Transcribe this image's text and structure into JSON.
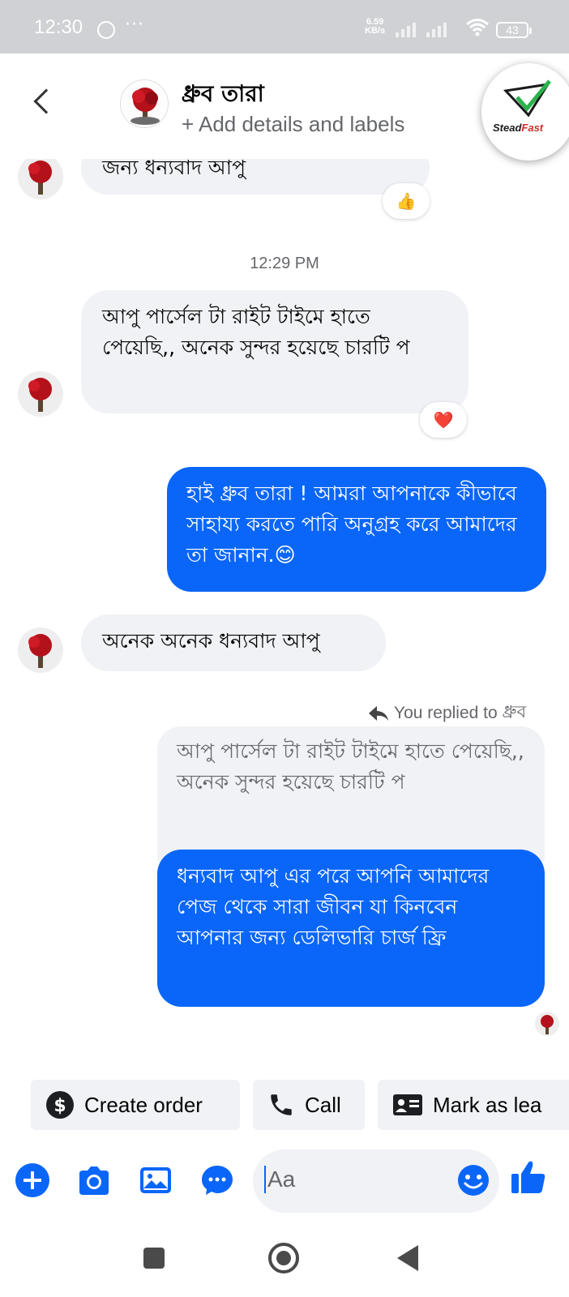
{
  "status_bar": {
    "time": "12:30",
    "dots": "···",
    "net_speed_value": "6.59",
    "net_speed_unit": "KB/s",
    "battery": "43"
  },
  "header": {
    "contact_name": "ধ্রুব তারা",
    "subtitle": "+ Add details and labels",
    "brand_name_a": "Stead",
    "brand_name_b": "Fast"
  },
  "messages": {
    "m1_text": "জন্য ধন্যবাদ আপু",
    "m1_reaction": "👍",
    "time_separator": "12:29 PM",
    "m2_text": "আপু পার্সেল টা রাইট টাইমে হাতে পেয়েছি,, অনেক সুন্দর হয়েছে চারটি প",
    "m2_reaction": "❤️",
    "m3_text": "হাই ধ্রুব তারা ! আমরা আপনাকে কীভাবে সাহায্য করতে পারি অনুগ্রহ করে আমাদের তা জানান.😊",
    "m4_text": "অনেক অনেক ধন্যবাদ আপু",
    "replied_label": "You replied to",
    "replied_name": "ধ্রুব",
    "quoted_text": "আপু পার্সেল টা রাইট টাইমে হাতে পেয়েছি,, অনেক সুন্দর হয়েছে চারটি প",
    "m5_text": "ধন্যবাদ আপু এর পরে আপনি আমাদের পেজ থেকে সারা জীবন যা কিনবেন আপনার জন্য ডেলিভারি চার্জ ফ্রি"
  },
  "quick_actions": {
    "create_order": "Create order",
    "call": "Call",
    "mark_as_lead": "Mark as lea"
  },
  "composer": {
    "placeholder": "Aa"
  },
  "colors": {
    "accent": "#0a66f8",
    "incoming_bubble": "#f0f2f5",
    "status_bar": "#cfd1d4"
  },
  "icons": [
    "messenger-icon",
    "wifi-icon",
    "back-icon",
    "plus-icon",
    "camera-icon",
    "gallery-icon",
    "chat-bubble-icon",
    "smiley-icon",
    "thumbs-up-icon",
    "dollar-icon",
    "phone-icon",
    "id-card-icon",
    "reply-icon",
    "stop-square-icon",
    "home-circle-icon",
    "back-triangle-icon"
  ]
}
